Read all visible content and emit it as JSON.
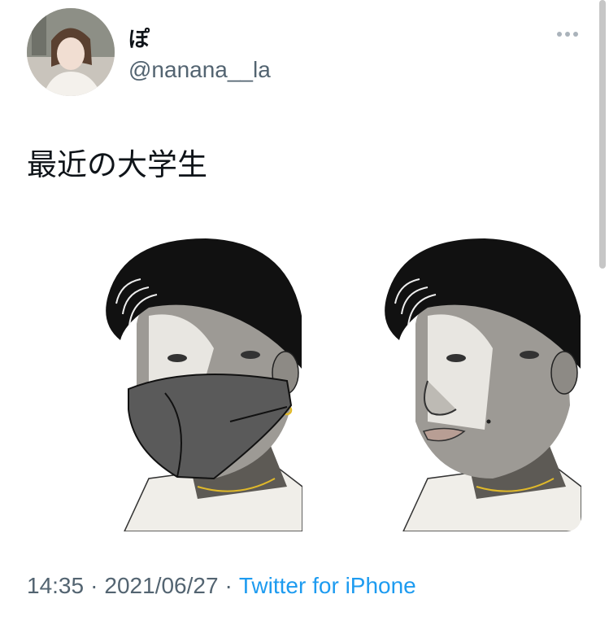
{
  "author": {
    "display_name": "ぽ",
    "handle": "@nanana__la",
    "avatar_icon": "profile-photo"
  },
  "more_icon": "more-horizontal-icon",
  "tweet": {
    "text": "最近の大学生"
  },
  "meta": {
    "time": "14:35",
    "date": "2021/06/27",
    "separator": "·",
    "source": "Twitter for iPhone"
  },
  "colors": {
    "text": "#0f1419",
    "secondary": "#536471",
    "link": "#1d9bf0"
  }
}
